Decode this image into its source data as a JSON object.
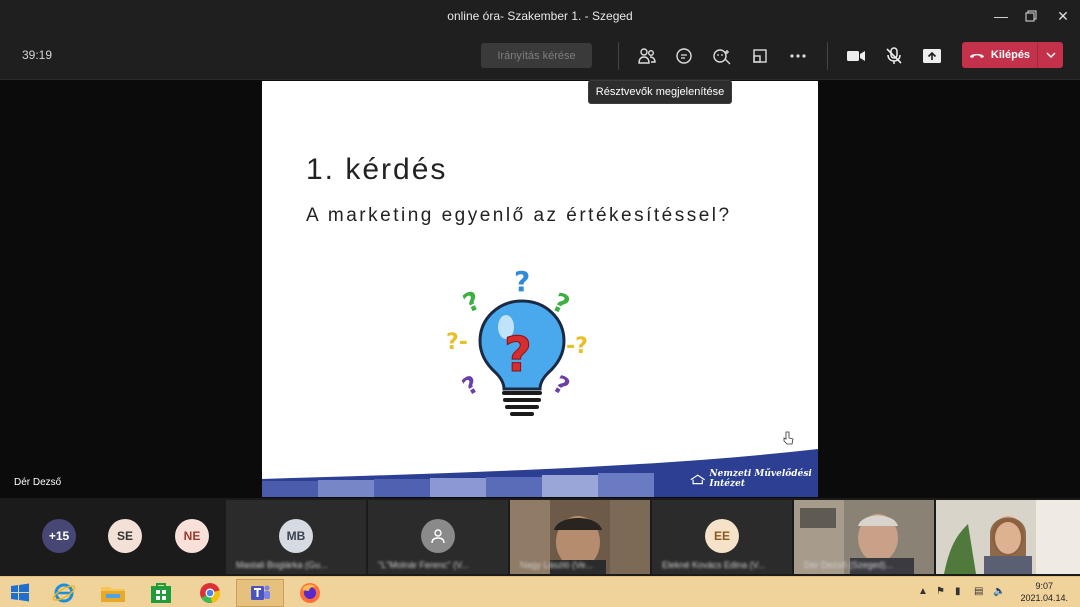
{
  "window": {
    "title": "online óra- Szakember 1. - Szeged"
  },
  "toolbar": {
    "timer": "39:19",
    "request_control": "Irányítás kérése",
    "leave_label": "Kilépés",
    "tooltip": "Résztvevők megjelenítése",
    "icons": [
      "participants-icon",
      "chat-icon",
      "reactions-icon",
      "rooms-icon",
      "more-icon",
      "camera-icon",
      "mic-off-icon",
      "share-icon"
    ]
  },
  "slide": {
    "title": "1. kérdés",
    "subtitle": "A marketing egyenlő az értékesítéssel?",
    "footer_logo_text": "Nemzeti Művelődési Intézet"
  },
  "presenter": {
    "name": "Dér Dezső"
  },
  "gallery": {
    "overflow_count": "+15",
    "avatars": [
      {
        "initials": "SE",
        "bg": "#f3e0d6",
        "fg": "#333333"
      },
      {
        "initials": "NE",
        "bg": "#f9e0d8",
        "fg": "#9c3a2c"
      }
    ],
    "tiles": [
      {
        "initials": "MB",
        "name": "Mastali Boglárka (Gu..."
      },
      {
        "initials": "",
        "name": "\"L\"Molnár Ferenc\" (V..."
      },
      {
        "initials": "",
        "name": "Nagy László (Ve..."
      },
      {
        "initials": "EE",
        "name": "Elekné Kovács Edina (V..."
      },
      {
        "initials": "",
        "name": "Dér Dezső (Szeged)..."
      },
      {
        "initials": "",
        "name": ""
      }
    ]
  },
  "taskbar": {
    "time": "9:07",
    "date": "2021.04.14."
  },
  "colors": {
    "leave": "#c4314b",
    "avatar_overflow": "#464775",
    "taskbar": "#f0d39b"
  }
}
